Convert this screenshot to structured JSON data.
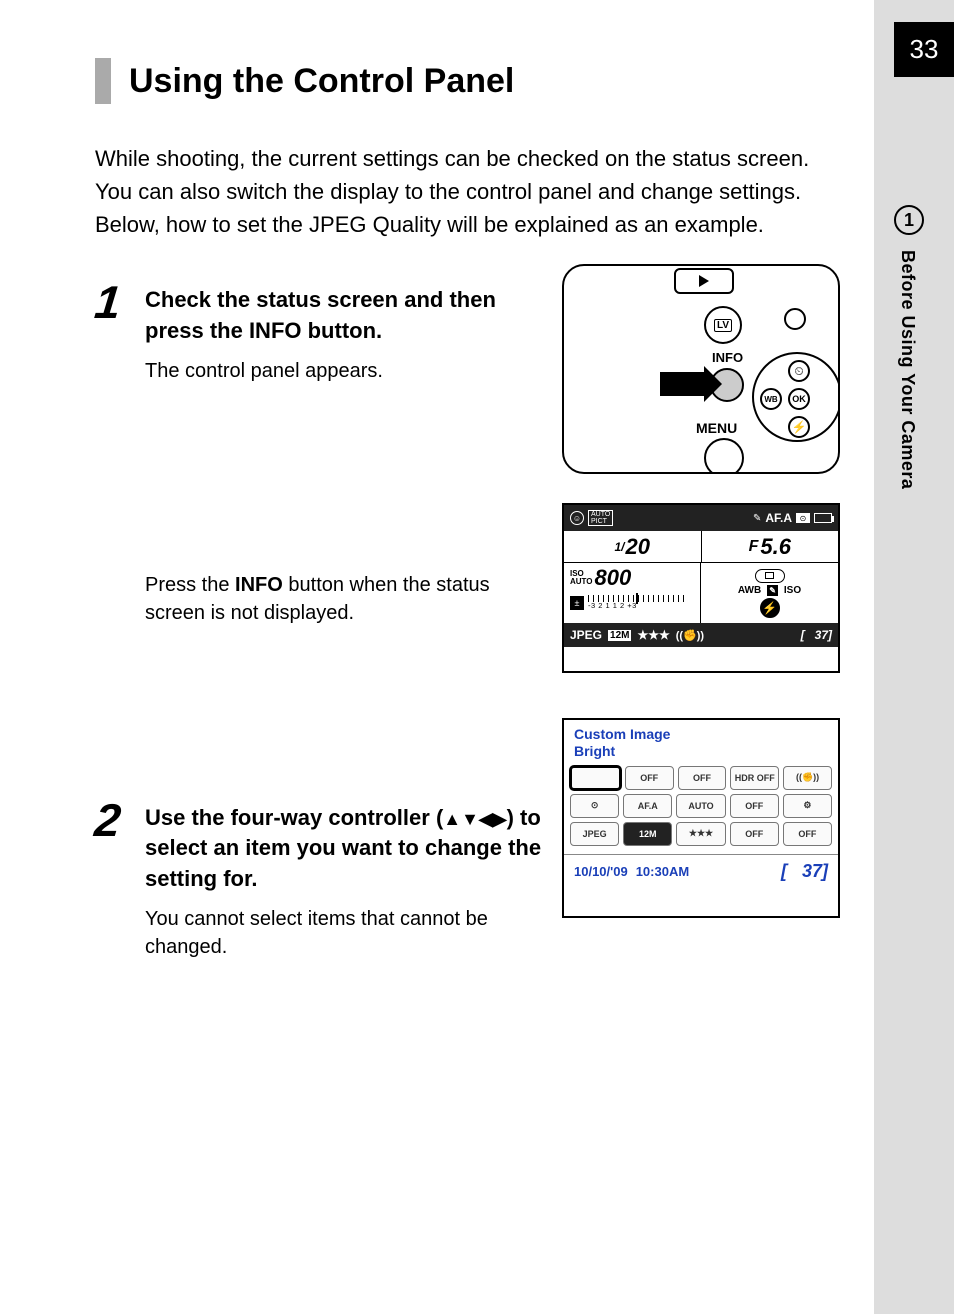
{
  "page_number": "33",
  "chapter": {
    "number": "1",
    "label": "Before Using Your Camera"
  },
  "title": "Using the Control Panel",
  "intro": "While shooting, the current settings can be checked on the status screen. You can also switch the display to the control panel and change settings. Below, how to set the JPEG Quality will be explained as an example.",
  "steps": {
    "s1": {
      "num": "1",
      "head_a": "Check the status screen and then press the ",
      "head_b": "INFO",
      "head_c": " button.",
      "sub": "The control panel appears.",
      "extra_a": "Press the ",
      "extra_b": "INFO",
      "extra_c": " button when the status screen is not displayed."
    },
    "s2": {
      "num": "2",
      "head_a": "Use the four-way controller (",
      "arrows": "▲▼◀▶",
      "head_b": ") to select an item you want to change the setting for.",
      "sub": "You cannot select items that cannot be changed."
    }
  },
  "diagram1": {
    "lv": "LV",
    "info": "INFO",
    "menu": "MENU",
    "ok": "OK",
    "wb": "WB",
    "timer": "⏲",
    "flash": "⚡"
  },
  "diagram2": {
    "top": {
      "face": "☺",
      "pict_a": "AUTO",
      "pict_b": "PICT",
      "afa": "AF.A"
    },
    "shutter_pre": "1/",
    "shutter": "20",
    "f_pre": "F",
    "aperture": "5.6",
    "iso_l1": "ISO",
    "iso_l2": "AUTO",
    "iso_val": "800",
    "ev_icon": "±",
    "ev_scale": "-3  2  1     1  2  +3",
    "awb": "AWB",
    "iso_r": "ISO",
    "flash": "⚡",
    "jpeg": "JPEG",
    "mp": "12M",
    "stars": "★★★",
    "shake": "((✊))",
    "remain_br": "[",
    "remain": "37]"
  },
  "diagram3": {
    "title1": "Custom Image",
    "title2": "Bright",
    "rows": [
      [
        "",
        "OFF",
        "OFF",
        "HDR OFF",
        "((✊))"
      ],
      [
        "⊙",
        "AF.A",
        "AUTO",
        "OFF",
        "⚙"
      ],
      [
        "JPEG",
        "12M",
        "★★★",
        "OFF",
        "OFF"
      ]
    ],
    "date": "10/10/'09",
    "time": "10:30AM",
    "remain_br": "[",
    "remain": "37]"
  }
}
